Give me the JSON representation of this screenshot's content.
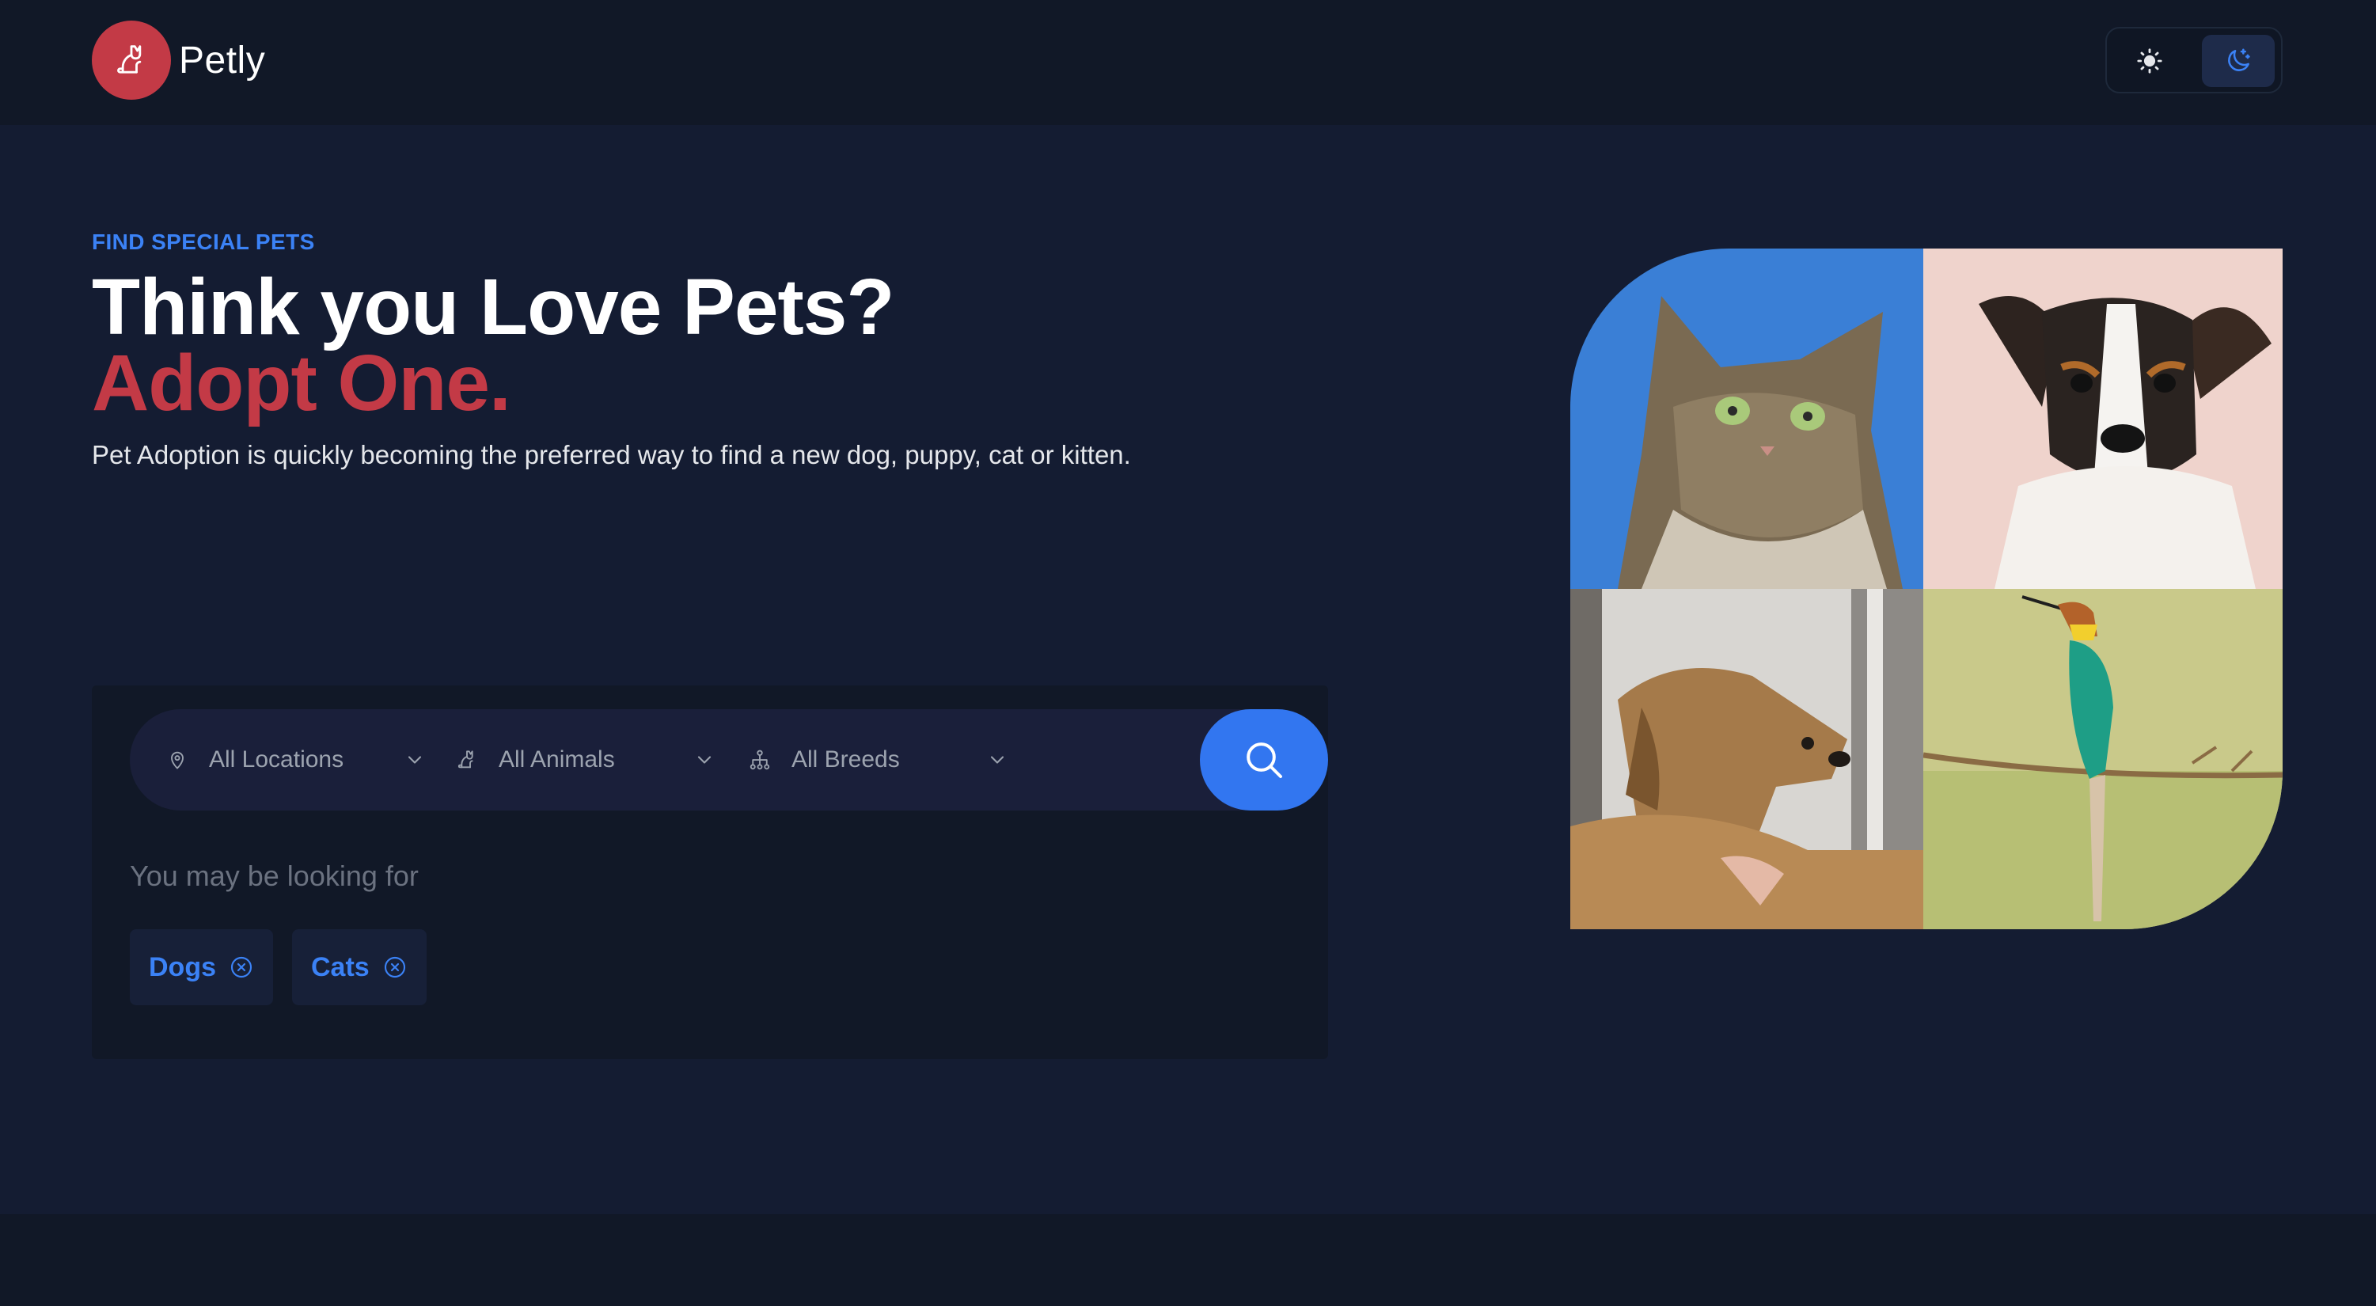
{
  "brand": {
    "name": "Petly",
    "logo_icon": "cat-icon",
    "logo_color": "#c33a46"
  },
  "theme_toggle": {
    "light_icon": "sun-icon",
    "dark_icon": "moon-icon",
    "active": "dark"
  },
  "hero": {
    "eyebrow": "FIND SPECIAL PETS",
    "headline": "Think you Love Pets?",
    "headline_accent": "Adopt One.",
    "subtext": "Pet Adoption is quickly becoming the preferred way to find a new dog, puppy, cat or kitten."
  },
  "search": {
    "filters": [
      {
        "icon": "map-pin-icon",
        "label": "All Locations"
      },
      {
        "icon": "cat-icon",
        "label": "All Animals"
      },
      {
        "icon": "hierarchy-icon",
        "label": "All Breeds"
      }
    ],
    "button_icon": "search-icon",
    "suggest_title": "You may be looking for",
    "chips": [
      {
        "label": "Dogs"
      },
      {
        "label": "Cats"
      }
    ]
  },
  "collage": {
    "photos": [
      "tabby cat on blue background",
      "terrier dog on pink background",
      "golden retriever being petted",
      "bee-eater bird on branch"
    ]
  },
  "colors": {
    "accent_blue": "#3b82f6",
    "accent_red": "#c33a46",
    "background": "#111827",
    "hero_background": "#141c32"
  }
}
